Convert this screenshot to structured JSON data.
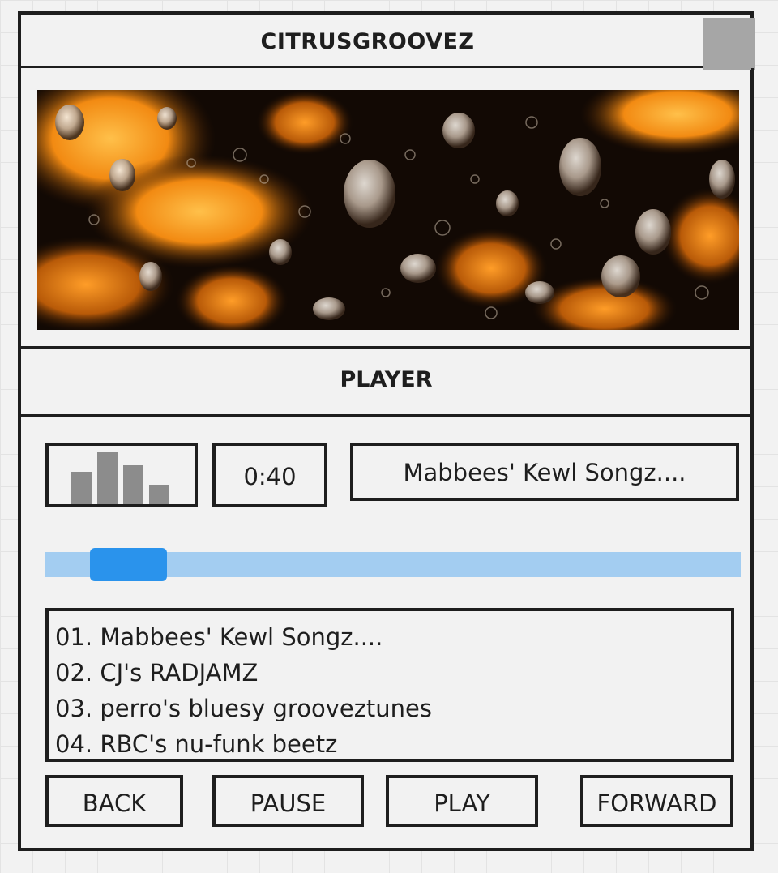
{
  "app": {
    "title": "CITRUSGROOVEZ"
  },
  "player": {
    "title": "PLAYER",
    "elapsed_time": "0:40",
    "now_playing": "Mabbees' Kewl Songz....",
    "progress": 0.06,
    "equalizer_levels": [
      0.62,
      1.0,
      0.75,
      0.38
    ]
  },
  "playlist": {
    "items": [
      "01. Mabbees' Kewl Songz....",
      "02. CJ's RADJAMZ",
      "03. perro's bluesy grooveztunes",
      "04. RBC's nu-funk beetz"
    ]
  },
  "controls": {
    "back_label": "BACK",
    "pause_label": "PAUSE",
    "play_label": "PLAY",
    "forward_label": "FORWARD"
  },
  "colors": {
    "outline": "#1e1e1e",
    "progress_track": "#a3cdf1",
    "progress_thumb": "#2a93ec",
    "equalizer_bar": "#8c8c8c",
    "art_orange": "#ff9a1f",
    "art_dark": "#120904"
  }
}
